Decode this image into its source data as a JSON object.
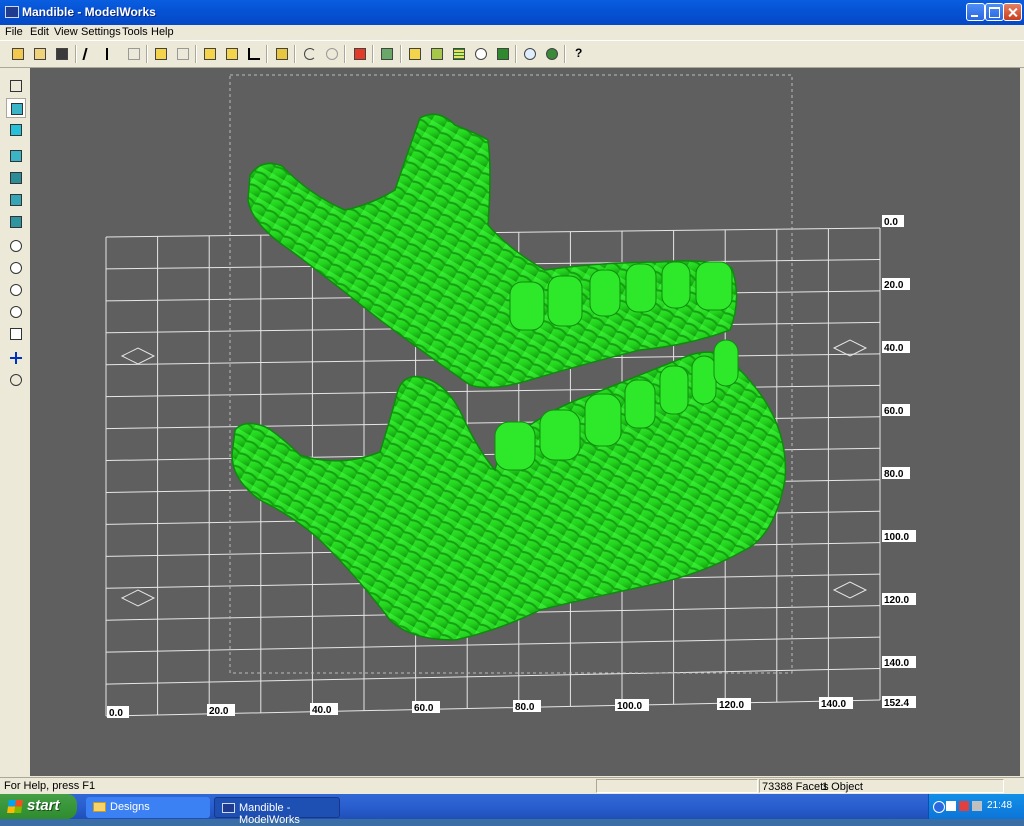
{
  "window": {
    "title": "Mandible - ModelWorks"
  },
  "menu": [
    "File",
    "Edit",
    "View",
    "Settings",
    "Tools",
    "Help"
  ],
  "toolbar": {
    "tools": [
      "open-folder",
      "open-file",
      "save",
      "select-arrow",
      "select-vertex",
      "select-edge",
      "align-top",
      "align-bottom",
      "move-up",
      "scale",
      "measure-angle",
      "split-vertical",
      "undo",
      "redo",
      "delete-object",
      "build-view",
      "box-view",
      "layers",
      "grid",
      "timer",
      "group-objects",
      "zoom-region",
      "zoom-window",
      "help"
    ]
  },
  "left_tools": [
    "cube-wire",
    "cube-select",
    "cube-solid",
    "view-front",
    "view-back",
    "view-left",
    "view-right",
    "zoom-in-point",
    "zoom-window",
    "zoom-in",
    "zoom-out",
    "zoom-fit",
    "pan",
    "rotate"
  ],
  "viewport": {
    "model_color": "#22e01a",
    "background_color": "#5f5f5f",
    "x_axis_labels": [
      "0.0",
      "20.0",
      "40.0",
      "60.0",
      "80.0",
      "100.0",
      "120.0",
      "140.0",
      "152.4"
    ],
    "y_axis_labels": [
      "0.0",
      "20.0",
      "40.0",
      "60.0",
      "80.0",
      "100.0",
      "120.0",
      "140.0"
    ]
  },
  "status": {
    "help": "For Help, press F1",
    "facets": "73388 Facets",
    "objects": "1 Object"
  },
  "taskbar": {
    "start": "start",
    "tasks": [
      "Designs",
      "Mandible - ModelWorks"
    ],
    "clock": "21:48"
  }
}
